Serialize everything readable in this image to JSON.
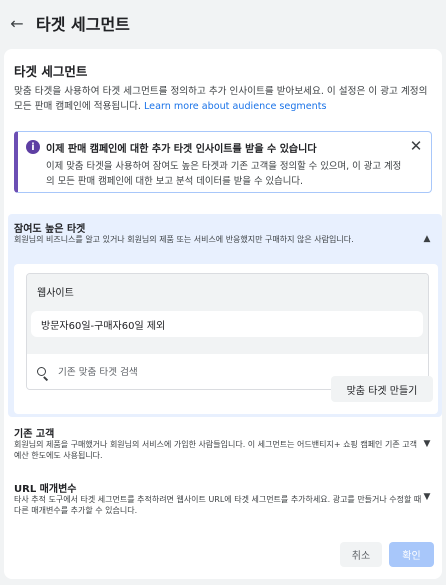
{
  "header": {
    "back_icon": "arrow-left-icon",
    "title": "타겟 세그먼트"
  },
  "section": {
    "title": "타겟 세그먼트",
    "description": "맞춤 타겟을 사용하여 타겟 세그먼트를 정의하고 추가 인사이트를 받아보세요. 이 설정은 이 광고 계정의 모든 판매 캠페인에 적용됩니다. ",
    "learn_more": "Learn more about audience segments"
  },
  "info_banner": {
    "icon": "info-icon",
    "title": "이제 판매 캠페인에 대한 추가 타겟 인사이트를 받을 수 있습니다",
    "body": "이제 맞춤 타겟을 사용하여 잠여도 높은 타겟과 기존 고객을 정의할 수 있으며, 이 광고 계정의 모든 판매 캠페인에 대한 보고 분석 데이터를 받을 수 있습니다."
  },
  "engaged": {
    "title": "잠여도 높은 타겟",
    "subtitle": "회원님의 비즈니스를 알고 있거나 회원님의 제품 또는 서비스에 반응했지만 구매하지 않은 사람입니다.",
    "website_label": "웹사이트",
    "website_chip": "방문자60일-구매자60일 제외",
    "search_placeholder": "기존 맞춤 타겟 검색",
    "make_button": "맞춤 타겟 만들기"
  },
  "existing": {
    "title": "기존 고객",
    "description": "회원님의 제품을 구매했거나 회원님의 서비스에 가입한 사람들입니다. 이 세그먼트는 어드밴티지+ 쇼핑 캠페인 기존 고객 예산 한도에도 사용됩니다."
  },
  "url_params": {
    "title": "URL 매개변수",
    "description": "타사 추적 도구에서 타겟 세그먼트를 추적하려면 웹사이트 URL에 타겟 세그먼트를 추가하세요. 광고를 만들거나 수정할 때 다른 매개변수를 추가할 수 있습니다."
  },
  "footer": {
    "cancel": "취소",
    "ok": "확인"
  },
  "colors": {
    "accent": "#1a73e8",
    "banner_border": "#6c4fb4",
    "panel_bg": "#e8f0fe",
    "ok_disabled": "#a8c7fa"
  }
}
